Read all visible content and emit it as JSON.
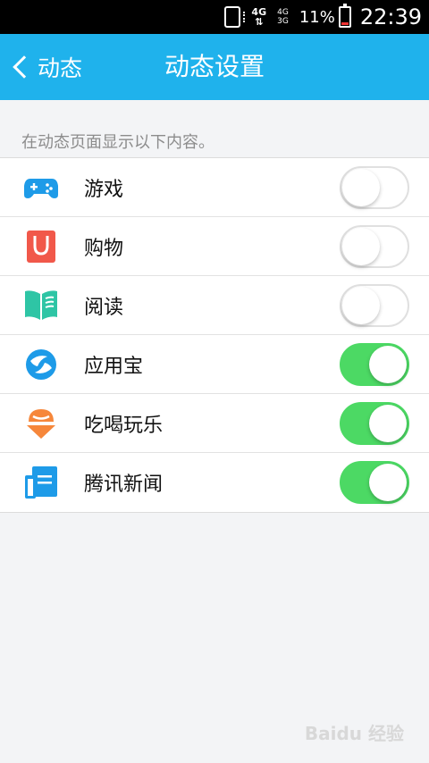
{
  "status_bar": {
    "network_type": "4G",
    "signal_labels": [
      "4G",
      "3G"
    ],
    "battery_percent": "11%",
    "time": "22:39"
  },
  "header": {
    "back_label": "动态",
    "title": "动态设置"
  },
  "hint": "在动态页面显示以下内容。",
  "items": [
    {
      "label": "游戏",
      "icon": "gamepad-icon",
      "enabled": false,
      "color": "#1e9be8"
    },
    {
      "label": "购物",
      "icon": "shopping-bag-icon",
      "enabled": false,
      "color": "#f1584a"
    },
    {
      "label": "阅读",
      "icon": "book-icon",
      "enabled": false,
      "color": "#2ec5a5"
    },
    {
      "label": "应用宝",
      "icon": "app-store-icon",
      "enabled": true,
      "color": "#1e9be8"
    },
    {
      "label": "吃喝玩乐",
      "icon": "food-icon",
      "enabled": true,
      "color": "#f6873b"
    },
    {
      "label": "腾讯新闻",
      "icon": "news-icon",
      "enabled": true,
      "color": "#1e9be8"
    }
  ],
  "colors": {
    "title_bar": "#1fb2ec",
    "switch_on": "#4cd964"
  },
  "watermark": "Baidu 经验"
}
